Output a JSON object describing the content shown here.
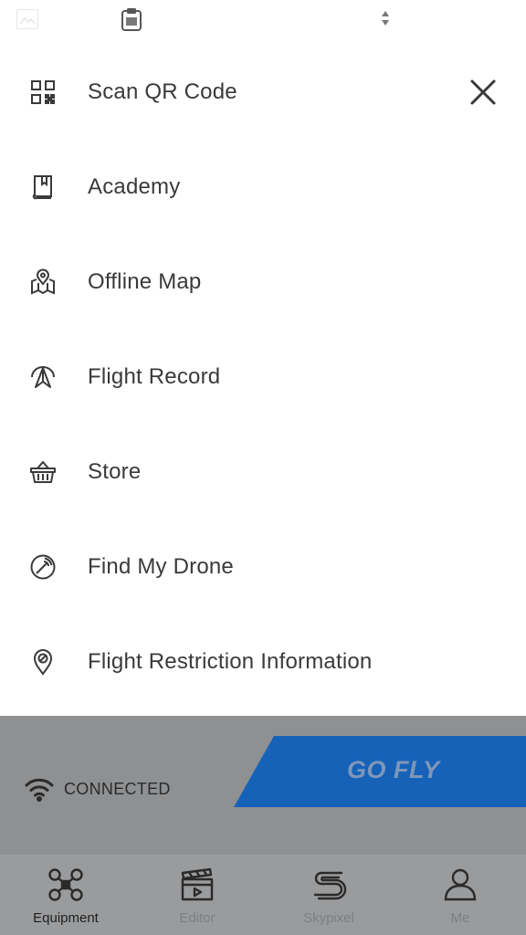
{
  "status_bar": {
    "icons": [
      "image-icon",
      "clipboard-icon",
      "sort-arrows-icon"
    ]
  },
  "menu": {
    "close_icon": "close-icon",
    "items": [
      {
        "label": "Scan QR Code",
        "icon": "qr-code-icon"
      },
      {
        "label": "Academy",
        "icon": "book-icon"
      },
      {
        "label": "Offline Map",
        "icon": "map-pin-icon"
      },
      {
        "label": "Flight Record",
        "icon": "flight-record-icon"
      },
      {
        "label": "Store",
        "icon": "basket-icon"
      },
      {
        "label": "Find My Drone",
        "icon": "radar-icon"
      },
      {
        "label": "Flight Restriction Information",
        "icon": "restriction-pin-icon"
      }
    ]
  },
  "connection": {
    "status": "CONNECTED",
    "icon": "wifi-icon"
  },
  "go_fly": {
    "label": "GO FLY",
    "color": "#1565c0"
  },
  "tabs": [
    {
      "label": "Equipment",
      "icon": "drone-icon",
      "active": true
    },
    {
      "label": "Editor",
      "icon": "clapperboard-icon",
      "active": false
    },
    {
      "label": "Skypixel",
      "icon": "skypixel-icon",
      "active": false
    },
    {
      "label": "Me",
      "icon": "person-icon",
      "active": false
    }
  ],
  "colors": {
    "overlay": "#8f9092",
    "tabbar": "#9a9b9d",
    "text": "#3a3a3a"
  }
}
